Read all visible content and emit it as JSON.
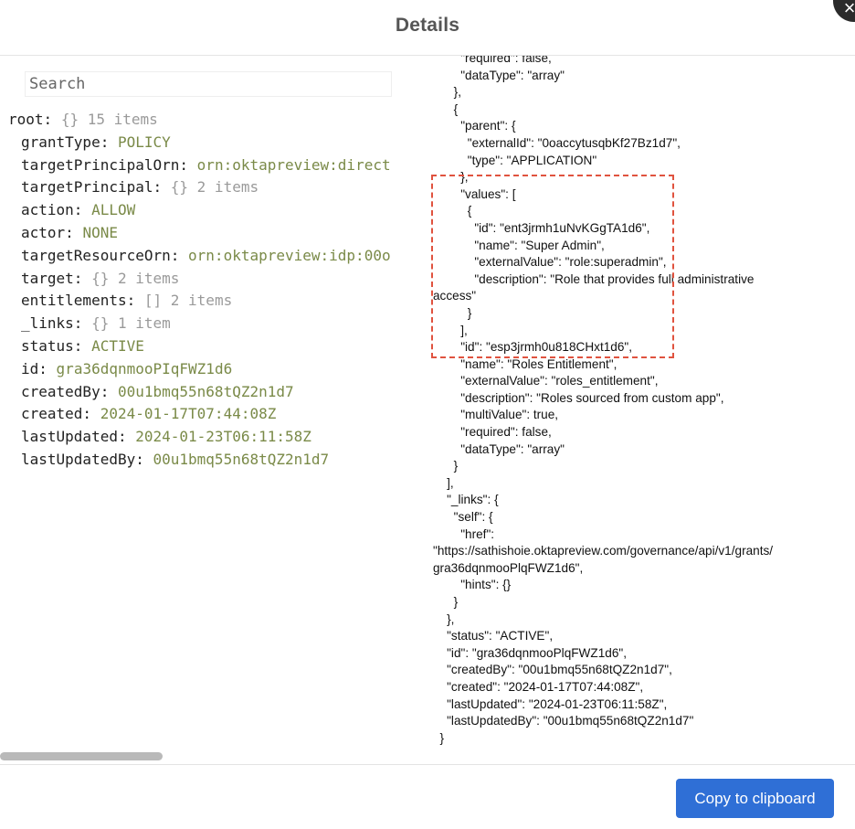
{
  "modal": {
    "title": "Details",
    "close_icon": "×",
    "copy_button_label": "Copy to clipboard"
  },
  "search": {
    "placeholder": "Search"
  },
  "tree": {
    "root": {
      "key": "root:",
      "meta": "{} 15 items"
    },
    "items": [
      {
        "key": "grantType:",
        "value": "POLICY",
        "meta": ""
      },
      {
        "key": "targetPrincipalOrn:",
        "value": "orn:oktapreview:direct",
        "meta": ""
      },
      {
        "key": "targetPrincipal:",
        "value": "",
        "meta": "{} 2 items"
      },
      {
        "key": "action:",
        "value": "ALLOW",
        "meta": ""
      },
      {
        "key": "actor:",
        "value": "NONE",
        "meta": ""
      },
      {
        "key": "targetResourceOrn:",
        "value": "orn:oktapreview:idp:00o",
        "meta": ""
      },
      {
        "key": "target:",
        "value": "",
        "meta": "{} 2 items"
      },
      {
        "key": "entitlements:",
        "value": "",
        "meta": "[] 2 items"
      },
      {
        "key": "_links:",
        "value": "",
        "meta": "{} 1 item"
      },
      {
        "key": "status:",
        "value": "ACTIVE",
        "meta": ""
      },
      {
        "key": "id:",
        "value": "gra36dqnmooPIqFWZ1d6",
        "meta": ""
      },
      {
        "key": "createdBy:",
        "value": "00u1bmq55n68tQZ2n1d7",
        "meta": ""
      },
      {
        "key": "created:",
        "value": "2024-01-17T07:44:08Z",
        "meta": ""
      },
      {
        "key": "lastUpdated:",
        "value": "2024-01-23T06:11:58Z",
        "meta": ""
      },
      {
        "key": "lastUpdatedBy:",
        "value": "00u1bmq55n68tQZ2n1d7",
        "meta": ""
      }
    ]
  },
  "json_lines": [
    "        \"required\": false,",
    "        \"dataType\": \"array\"",
    "      },",
    "      {",
    "        \"parent\": {",
    "          \"externalId\": \"0oaccytusqbKf27Bz1d7\",",
    "          \"type\": \"APPLICATION\"",
    "        },",
    "        \"values\": [",
    "          {",
    "            \"id\": \"ent3jrmh1uNvKGgTA1d6\",",
    "            \"name\": \"Super Admin\",",
    "            \"externalValue\": \"role:superadmin\",",
    "            \"description\": \"Role that provides full administrative",
    "access\"",
    "          }",
    "        ],",
    "        \"id\": \"esp3jrmh0u818CHxt1d6\",",
    "        \"name\": \"Roles Entitlement\",",
    "        \"externalValue\": \"roles_entitlement\",",
    "        \"description\": \"Roles sourced from custom app\",",
    "        \"multiValue\": true,",
    "        \"required\": false,",
    "        \"dataType\": \"array\"",
    "      }",
    "    ],",
    "    \"_links\": {",
    "      \"self\": {",
    "        \"href\":",
    "\"https://sathishoie.oktapreview.com/governance/api/v1/grants/",
    "gra36dqnmooPlqFWZ1d6\",",
    "        \"hints\": {}",
    "      }",
    "    },",
    "    \"status\": \"ACTIVE\",",
    "    \"id\": \"gra36dqnmooPlqFWZ1d6\",",
    "    \"createdBy\": \"00u1bmq55n68tQZ2n1d7\",",
    "    \"created\": \"2024-01-17T07:44:08Z\",",
    "    \"lastUpdated\": \"2024-01-23T06:11:58Z\",",
    "    \"lastUpdatedBy\": \"00u1bmq55n68tQZ2n1d7\"",
    "  }"
  ],
  "colors": {
    "accent": "#2f6fd6",
    "highlight": "#e0533f",
    "value_text": "#7a8a48",
    "meta_text": "#9a9a9a"
  }
}
